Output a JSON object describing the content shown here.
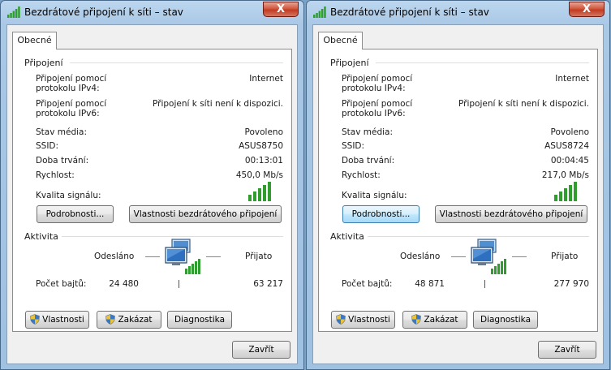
{
  "windows": [
    {
      "title": "Bezdrátové připojení k síti – stav",
      "close": "X",
      "tab": "Obecné",
      "connection_group": "Připojení",
      "ipv4_label": [
        "Připojení pomocí",
        "protokolu IPv4:"
      ],
      "ipv4_value": "Internet",
      "ipv6_label": [
        "Připojení pomocí",
        "protokolu IPv6:"
      ],
      "ipv6_value": "Připojení k síti není k dispozici.",
      "media_label": "Stav média:",
      "media_value": "Povoleno",
      "ssid_label": "SSID:",
      "ssid_value": "ASUS8750",
      "duration_label": "Doba trvání:",
      "duration_value": "00:13:01",
      "speed_label": "Rychlost:",
      "speed_value": "450,0 Mb/s",
      "signal_label": "Kvalita signálu:",
      "details_button": "Podrobnosti...",
      "wireless_props_button": "Vlastnosti bezdrátového připojení",
      "activity_group": "Aktivita",
      "sent_label": "Odesláno",
      "received_label": "Přijato",
      "bytes_label": "Počet bajtů:",
      "bytes_sent": "24 480",
      "bytes_received": "63 217",
      "properties_button": "Vlastnosti",
      "disable_button": "Zakázat",
      "diagnose_button": "Diagnostika",
      "close_button": "Zavřít"
    },
    {
      "title": "Bezdrátové připojení k síti – stav",
      "close": "X",
      "tab": "Obecné",
      "connection_group": "Připojení",
      "ipv4_label": [
        "Připojení pomocí",
        "protokolu IPv4:"
      ],
      "ipv4_value": "Internet",
      "ipv6_label": [
        "Připojení pomocí",
        "protokolu IPv6:"
      ],
      "ipv6_value": "Připojení k síti není k dispozici.",
      "media_label": "Stav média:",
      "media_value": "Povoleno",
      "ssid_label": "SSID:",
      "ssid_value": "ASUS8724",
      "duration_label": "Doba trvání:",
      "duration_value": "00:04:45",
      "speed_label": "Rychlost:",
      "speed_value": "217,0 Mb/s",
      "signal_label": "Kvalita signálu:",
      "details_button": "Podrobnosti...",
      "wireless_props_button": "Vlastnosti bezdrátového připojení",
      "activity_group": "Aktivita",
      "sent_label": "Odesláno",
      "received_label": "Přijato",
      "bytes_label": "Počet bajtů:",
      "bytes_sent": "48 871",
      "bytes_received": "277 970",
      "properties_button": "Vlastnosti",
      "disable_button": "Zakázat",
      "diagnose_button": "Diagnostika",
      "close_button": "Zavřít"
    }
  ],
  "icons": {
    "title": "signal-bars-icon",
    "shield": "uac-shield-icon",
    "network": "network-computers-icon"
  },
  "colors": {
    "signal_green": "#2f9e2f",
    "close_red": "#c23c22",
    "focus_blue": "#3c7fb1"
  }
}
